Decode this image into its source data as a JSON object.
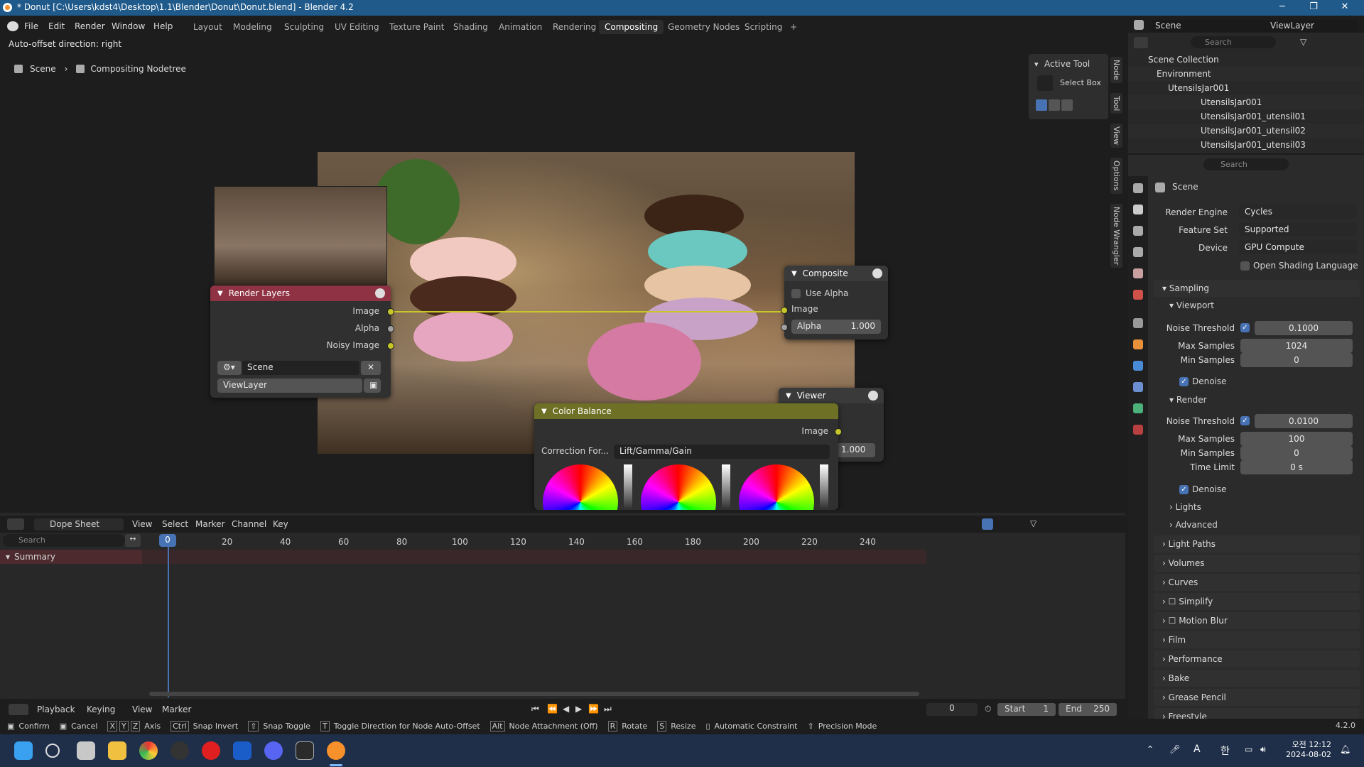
{
  "window": {
    "title": "* Donut [C:\\Users\\kdst4\\Desktop\\1.1\\Blender\\Donut\\Donut.blend] - Blender 4.2",
    "minimize": "─",
    "maximize": "❐",
    "close": "✕"
  },
  "menu": [
    "File",
    "Edit",
    "Render",
    "Window",
    "Help"
  ],
  "workspaces": [
    "Layout",
    "Modeling",
    "Sculpting",
    "UV Editing",
    "Texture Paint",
    "Shading",
    "Animation",
    "Rendering",
    "Compositing",
    "Geometry Nodes",
    "Scripting"
  ],
  "active_workspace": "Compositing",
  "add_workspace": "+",
  "status_hint": "Auto-offset direction: right",
  "breadcrumb": {
    "scene": "Scene",
    "tree": "Compositing Nodetree"
  },
  "scene_selector": {
    "scene": "Scene",
    "view_layer": "ViewLayer"
  },
  "nodes": {
    "render_layers": {
      "title": "Render Layers",
      "outputs": [
        "Image",
        "Alpha",
        "Noisy Image"
      ],
      "scene": "Scene",
      "view_layer": "ViewLayer"
    },
    "composite": {
      "title": "Composite",
      "use_alpha": "Use Alpha",
      "input_image": "Image",
      "alpha_label": "Alpha",
      "alpha_value": "1.000"
    },
    "viewer": {
      "title": "Viewer",
      "alpha_value": "1.000"
    },
    "color_balance": {
      "title": "Color Balance",
      "output": "Image",
      "correction_label": "Correction For...",
      "correction_value": "Lift/Gamma/Gain"
    }
  },
  "active_tool": {
    "title": "Active Tool",
    "tool": "Select Box"
  },
  "sidebar_tabs": [
    "Node",
    "Tool",
    "View",
    "Options",
    "Node Wrangler"
  ],
  "outliner": {
    "search_placeholder": "Search",
    "items": [
      {
        "label": "Scene Collection",
        "depth": 0
      },
      {
        "label": "Environment",
        "depth": 1
      },
      {
        "label": "UtensilsJar001",
        "depth": 2
      },
      {
        "label": "UtensilsJar001",
        "depth": 3
      },
      {
        "label": "UtensilsJar001_utensil01",
        "depth": 3
      },
      {
        "label": "UtensilsJar001_utensil02",
        "depth": 3
      },
      {
        "label": "UtensilsJar001_utensil03",
        "depth": 3
      }
    ]
  },
  "properties": {
    "search_placeholder": "Search",
    "context": "Scene",
    "render_engine_label": "Render Engine",
    "render_engine": "Cycles",
    "feature_set_label": "Feature Set",
    "feature_set": "Supported",
    "device_label": "Device",
    "device": "GPU Compute",
    "osl_label": "Open Shading Language",
    "sampling": "Sampling",
    "viewport": "Viewport",
    "noise_threshold_label": "Noise Threshold",
    "viewport_noise_threshold": "0.1000",
    "max_samples_label": "Max Samples",
    "viewport_max_samples": "1024",
    "min_samples_label": "Min Samples",
    "viewport_min_samples": "0",
    "denoise_label": "Denoise",
    "render": "Render",
    "render_noise_threshold": "0.0100",
    "render_max_samples": "100",
    "render_min_samples": "0",
    "time_limit_label": "Time Limit",
    "time_limit": "0 s",
    "lights": "Lights",
    "advanced": "Advanced",
    "sections": [
      "Light Paths",
      "Volumes",
      "Curves",
      "Simplify",
      "Motion Blur",
      "Film",
      "Performance",
      "Bake",
      "Grease Pencil",
      "Freestyle"
    ]
  },
  "dopesheet": {
    "mode": "Dope Sheet",
    "menus": [
      "View",
      "Select",
      "Marker",
      "Channel",
      "Key"
    ],
    "search_placeholder": "Search",
    "summary": "Summary",
    "current_frame": "0",
    "ticks": [
      "20",
      "40",
      "60",
      "80",
      "100",
      "120",
      "140",
      "160",
      "180",
      "200",
      "220",
      "240"
    ]
  },
  "playback": {
    "menus": [
      "Playback",
      "Keying",
      "View",
      "Marker"
    ],
    "frame": "0",
    "start_label": "Start",
    "start": "1",
    "end_label": "End",
    "end": "250"
  },
  "statusbar": {
    "items": [
      "Confirm",
      "Cancel",
      "X",
      "Y",
      "Z",
      "Axis",
      "Ctrl",
      "Snap Invert",
      "⇧",
      "Snap Toggle",
      "T",
      "Toggle Direction for Node Auto-Offset",
      "Alt",
      "Node Attachment (Off)",
      "R",
      "Rotate",
      "S",
      "Resize",
      "Automatic Constraint",
      "Precision Mode"
    ],
    "version": "4.2.0"
  },
  "taskbar": {
    "time": "오전 12:12",
    "date": "2024-08-02",
    "ime": "A",
    "ime2": "한"
  },
  "colors": {
    "accent": "#4772b3",
    "render_layers_header": "#8f3244",
    "output_header": "#3a3a3a",
    "color_node_header": "#6e7125",
    "link": "#c7c729"
  }
}
